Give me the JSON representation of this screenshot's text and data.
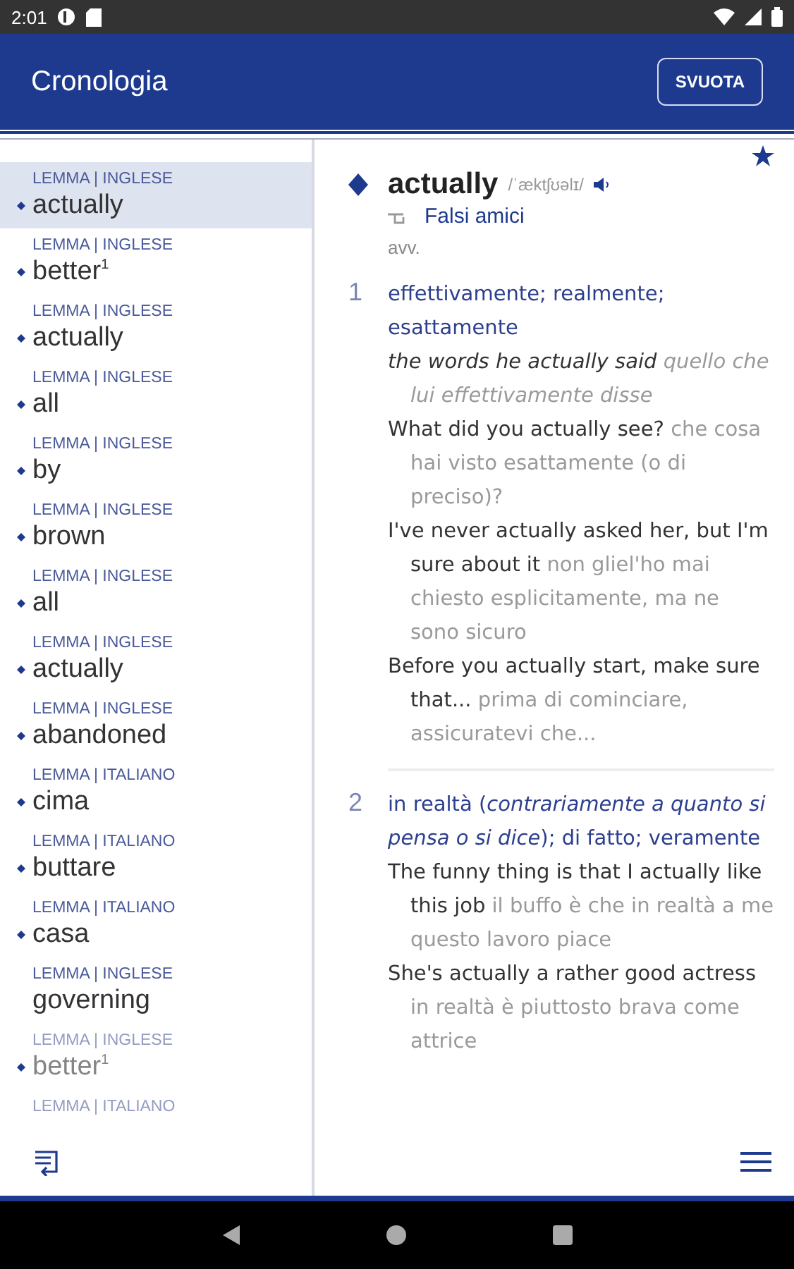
{
  "status_bar": {
    "time": "2:01"
  },
  "app_bar": {
    "title": "Cronologia",
    "button": "SVUOTA"
  },
  "history": [
    {
      "label": "LEMMA | INGLESE",
      "word": "actually",
      "bullet": true,
      "selected": true
    },
    {
      "label": "LEMMA | INGLESE",
      "word": "better",
      "sup": "1",
      "bullet": true,
      "selected": false
    },
    {
      "label": "LEMMA | INGLESE",
      "word": "actually",
      "bullet": true,
      "selected": false
    },
    {
      "label": "LEMMA | INGLESE",
      "word": "all",
      "bullet": true,
      "selected": false
    },
    {
      "label": "LEMMA | INGLESE",
      "word": "by",
      "bullet": true,
      "selected": false
    },
    {
      "label": "LEMMA | INGLESE",
      "word": "brown",
      "bullet": true,
      "selected": false
    },
    {
      "label": "LEMMA | INGLESE",
      "word": "all",
      "bullet": true,
      "selected": false
    },
    {
      "label": "LEMMA | INGLESE",
      "word": "actually",
      "bullet": true,
      "selected": false
    },
    {
      "label": "LEMMA | INGLESE",
      "word": "abandoned",
      "bullet": true,
      "selected": false
    },
    {
      "label": "LEMMA | ITALIANO",
      "word": "cima",
      "bullet": true,
      "selected": false
    },
    {
      "label": "LEMMA | ITALIANO",
      "word": "buttare",
      "bullet": true,
      "selected": false
    },
    {
      "label": "LEMMA | ITALIANO",
      "word": "casa",
      "bullet": true,
      "selected": false
    },
    {
      "label": "LEMMA | INGLESE",
      "word": "governing",
      "bullet": false,
      "selected": false
    },
    {
      "label": "LEMMA | INGLESE",
      "word": "better",
      "sup": "1",
      "bullet": true,
      "selected": false
    },
    {
      "label": "LEMMA | ITALIANO",
      "selected": false
    }
  ],
  "entry": {
    "headword": "actually",
    "pronunciation": "/ˈæktʃʊəlɪ/",
    "favorite": true,
    "link": "Falsi amici",
    "pos": "avv.",
    "senses": [
      {
        "number": "1",
        "translation": "effettivamente; realmente; esattamente",
        "examples": [
          {
            "en": "the words he actually said",
            "it": "quello che lui effettivamente disse",
            "italic": true
          },
          {
            "en": "What did you actually see?",
            "it": "che cosa hai visto esattamente (o di preciso)?",
            "italic": false
          },
          {
            "en": "I've never actually asked her, but I'm sure about it",
            "it": "non gliel'ho mai chiesto esplicitamente, ma ne sono sicuro",
            "italic": false
          },
          {
            "en": "Before you actually start, make sure that...",
            "it": "prima di cominciare, assicuratevi che...",
            "italic": false
          }
        ]
      },
      {
        "number": "2",
        "translation": "in realtà (*contrariamente a quanto si pensa o si dice*); di fatto; veramente",
        "examples": [
          {
            "en": "The funny thing is that I actually like this job",
            "it": "il buffo è che in realtà a me questo lavoro piace",
            "italic": false
          },
          {
            "en": "She's actually a rather good actress",
            "it": "in realtà è piuttosto brava come attrice",
            "italic": false
          }
        ]
      }
    ]
  }
}
